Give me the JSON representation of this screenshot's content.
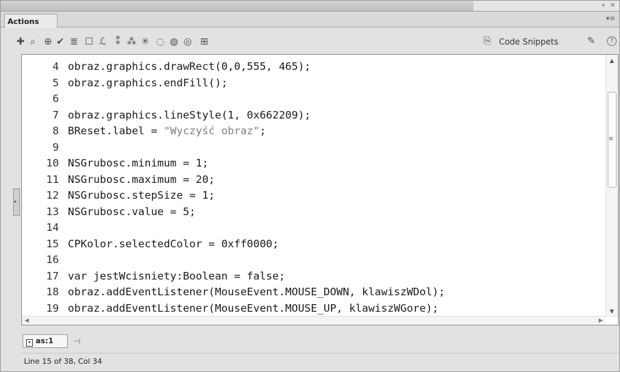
{
  "window": {
    "controls": "« ×"
  },
  "tabs": {
    "active_label": "Actions",
    "menu_glyph": "▾≡"
  },
  "toolbar": {
    "icons": [
      {
        "name": "add-statement-icon",
        "glyph": "✚"
      },
      {
        "name": "find-icon",
        "glyph": "⌕"
      },
      {
        "name": "insert-target-path-icon",
        "glyph": "⊕"
      },
      {
        "name": "check-syntax-icon",
        "glyph": "✔"
      },
      {
        "name": "auto-format-icon",
        "glyph": "≣"
      },
      {
        "name": "code-hint-icon",
        "glyph": "☐"
      },
      {
        "name": "debug-options-icon",
        "glyph": "ℒ"
      },
      {
        "name": "collapse-between-braces-icon",
        "glyph": "⁑"
      },
      {
        "name": "collapse-selection-icon",
        "glyph": "⁂"
      },
      {
        "name": "expand-all-icon",
        "glyph": "✳"
      },
      {
        "name": "apply-block-comment-icon",
        "glyph": "◌"
      },
      {
        "name": "apply-line-comment-icon",
        "glyph": "◍"
      },
      {
        "name": "remove-comment-icon",
        "glyph": "◎"
      },
      {
        "name": "show-hide-toolbox-icon",
        "glyph": "⊞"
      }
    ],
    "snippets_label": "Code Snippets"
  },
  "editor": {
    "lines": [
      {
        "n": "4",
        "code": "obraz.graphics.drawRect(0,0,555, 465);"
      },
      {
        "n": "5",
        "code": "obraz.graphics.endFill();"
      },
      {
        "n": "6",
        "code": ""
      },
      {
        "n": "7",
        "code": "obraz.graphics.lineStyle(1, 0x662209);"
      },
      {
        "n": "8",
        "code": "BReset.label = ",
        "str": "\"Wyczyść obraz\"",
        "tail": ";"
      },
      {
        "n": "9",
        "code": ""
      },
      {
        "n": "10",
        "code": "NSGrubosc.minimum = 1;"
      },
      {
        "n": "11",
        "code": "NSGrubosc.maximum = 20;"
      },
      {
        "n": "12",
        "code": "NSGrubosc.stepSize = 1;"
      },
      {
        "n": "13",
        "code": "NSGrubosc.value = 5;"
      },
      {
        "n": "14",
        "code": ""
      },
      {
        "n": "15",
        "code": "CPKolor.selectedColor = 0xff0000;"
      },
      {
        "n": "16",
        "code": ""
      },
      {
        "n": "17",
        "code": "var jestWcisniety:Boolean = false;"
      },
      {
        "n": "18",
        "code": "obraz.addEventListener(MouseEvent.MOUSE_DOWN, klawiszWDol);"
      },
      {
        "n": "19",
        "code": "obraz.addEventListener(MouseEvent.MOUSE_UP, klawiszWGore);"
      }
    ]
  },
  "file_tab": {
    "label": "as:1"
  },
  "status": {
    "text": "Line 15 of 38, Col 34"
  }
}
